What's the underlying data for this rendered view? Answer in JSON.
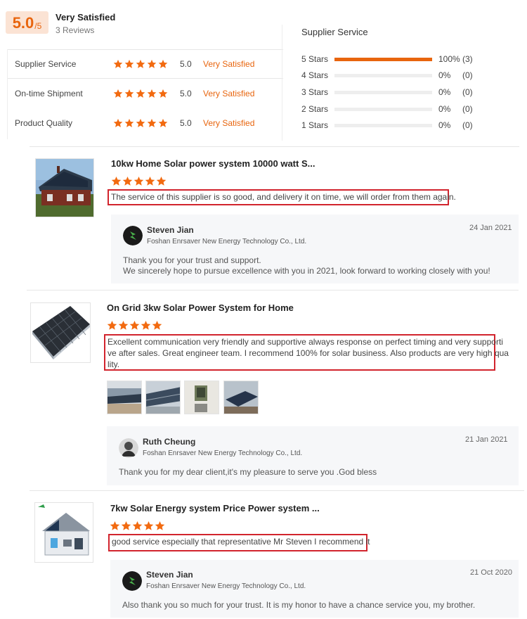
{
  "summary": {
    "score": "5.0",
    "score_denominator": "/5",
    "rating_text": "Very Satisfied",
    "reviews_count": "3 Reviews",
    "rows": [
      {
        "label": "Supplier Service",
        "value": "5.0",
        "desc": "Very Satisfied",
        "stars": 5
      },
      {
        "label": "On-time Shipment",
        "value": "5.0",
        "desc": "Very Satisfied",
        "stars": 5
      },
      {
        "label": "Product Quality",
        "value": "5.0",
        "desc": "Very Satisfied",
        "stars": 5
      }
    ]
  },
  "distribution": {
    "title": "Supplier Service",
    "rows": [
      {
        "label": "5 Stars",
        "percent": "100%",
        "count": "(3)",
        "fraction": 1.0
      },
      {
        "label": "4 Stars",
        "percent": "0%",
        "count": "(0)",
        "fraction": 0
      },
      {
        "label": "3 Stars",
        "percent": "0%",
        "count": "(0)",
        "fraction": 0
      },
      {
        "label": "2 Stars",
        "percent": "0%",
        "count": "(0)",
        "fraction": 0
      },
      {
        "label": "1 Stars",
        "percent": "0%",
        "count": "(0)",
        "fraction": 0
      }
    ]
  },
  "reviews": [
    {
      "title": "10kw Home Solar power system 10000 watt S...",
      "stars": 5,
      "text": "The service of this supplier is so good, and delivery it on time, we will order from them again.",
      "reply": {
        "name": "Steven Jian",
        "company": "Foshan Enrsaver New Energy Technology Co., Ltd.",
        "date": "24 Jan 2021",
        "text_line1": "Thank you for your trust and support.",
        "text_line2": "We sincerely hope to pursue excellence with you in 2021, look forward to working closely with you!"
      }
    },
    {
      "title": "On Grid 3kw Solar Power System for Home",
      "stars": 5,
      "text_line1": "Excellent communication very friendly and supportive always response on perfect timing and very supporti",
      "text_line2": "ve after sales. Great engineer team. I recommend 100% for solar business. Also products are very high qua",
      "text_line3": "lity.",
      "reply": {
        "name": "Ruth Cheung",
        "company": "Foshan Enrsaver New Energy Technology Co., Ltd.",
        "date": "21 Jan 2021",
        "text": "Thank you for my dear client,it's my pleasure to serve you .God bless"
      }
    },
    {
      "title": "7kw Solar Energy system Price Power system ...",
      "stars": 5,
      "text": "good service especially that representative Mr Steven I recommend it",
      "reply": {
        "name": "Steven Jian",
        "company": "Foshan Enrsaver New Energy Technology Co., Ltd.",
        "date": "21 Oct 2020",
        "text": "Also thank you so much for your trust. It is my honor to have a chance service you, my brother."
      }
    }
  ],
  "colors": {
    "accent": "#e8650e",
    "star": "#f26a10",
    "highlight": "#d2242d"
  }
}
